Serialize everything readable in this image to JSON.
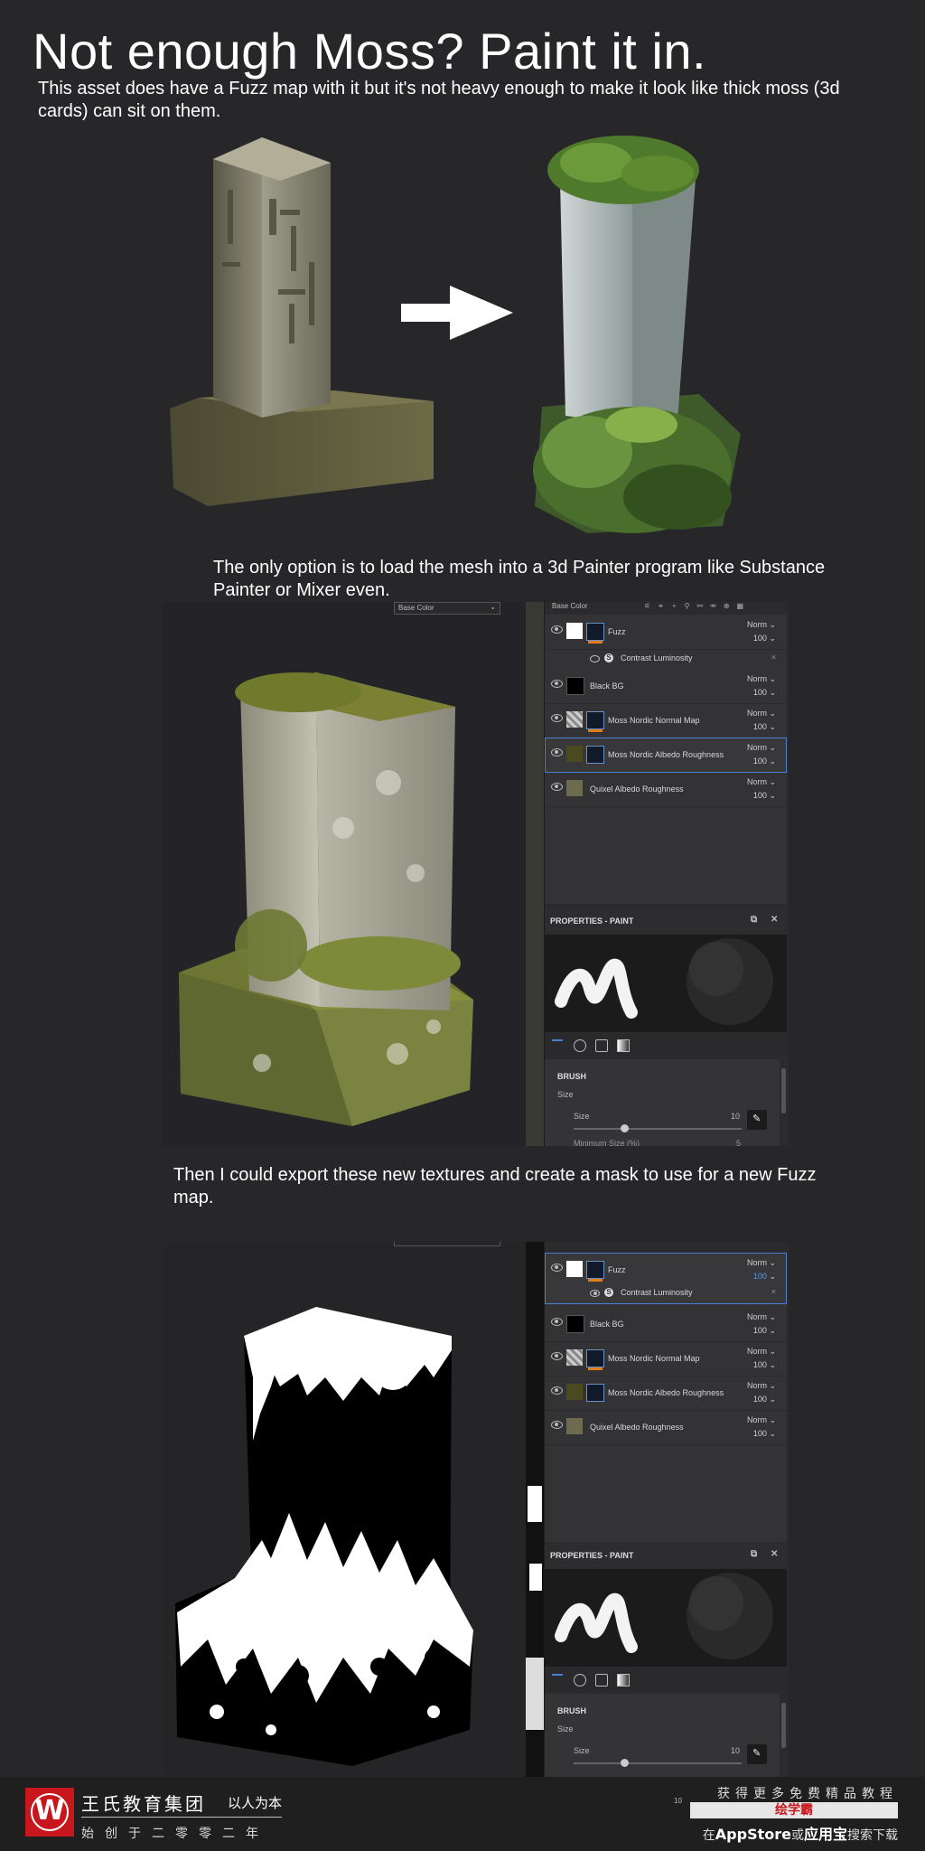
{
  "title": "Not enough Moss? Paint it in.",
  "intro": "This asset does have a Fuzz map with it but it's not heavy enough to make it look like thick moss (3d cards) can sit on them.",
  "caption1": "The only option is to load the mesh into a 3d Painter program like Substance Painter or Mixer even.",
  "caption2": "Then I could export these new textures and create a mask to use for a new Fuzz map.",
  "viewport1": {
    "channel_select": "Base Color",
    "dropdown_small": "Base Color"
  },
  "layers": [
    {
      "name": "Fuzz",
      "blend": "Norm",
      "opacity": "100"
    },
    {
      "name": "Black BG",
      "blend": "Norm",
      "opacity": "100"
    },
    {
      "name": "Moss Nordic Normal Map",
      "blend": "Norm",
      "opacity": "100"
    },
    {
      "name": "Moss Nordic Albedo Roughness",
      "blend": "Norm",
      "opacity": "100"
    },
    {
      "name": "Quixel Albedo Roughness",
      "blend": "Norm",
      "opacity": "100"
    }
  ],
  "filter": {
    "name": "Contrast Luminosity",
    "close": "×"
  },
  "properties": {
    "title": "PROPERTIES - PAINT",
    "section": "BRUSH",
    "size_group": "Size",
    "size_label": "Size",
    "size_value": "10",
    "size_fraction": 0.3,
    "min_size_label": "Minimum Size (%)",
    "min_size_value": "5"
  },
  "footer": {
    "logo_letter": "W",
    "company": "王氏教育集团",
    "slogan": "以人为本",
    "founded": "始创于二零零二年",
    "promo": "获得更多免费精品教程",
    "brand": "绘学霸",
    "store_prefix": "在",
    "store_app": "AppStore",
    "store_or": "或",
    "store_alt": "应用宝",
    "store_suffix": "搜索下载",
    "stray_value": "10"
  },
  "colors": {
    "background": "#272729",
    "accent": "#e07b1f",
    "selection": "#4a7fd1",
    "brand_red": "#c7161c"
  }
}
